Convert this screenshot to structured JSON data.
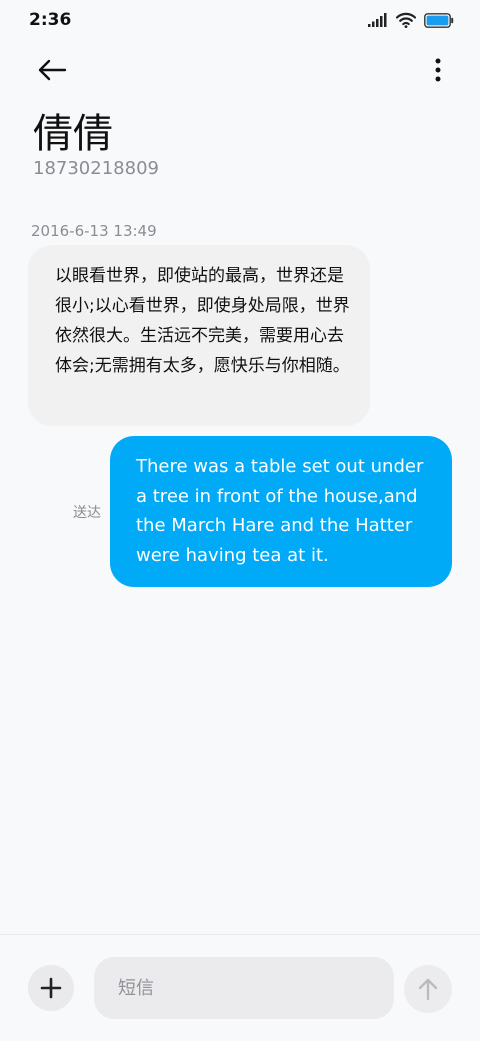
{
  "status_bar": {
    "time": "2:36",
    "icons": [
      "signal-icon",
      "wifi-icon",
      "battery-icon"
    ],
    "battery_color": "#1a9cf0"
  },
  "app_bar": {
    "back_icon": "arrow-left-icon",
    "more_icon": "more-vertical-icon"
  },
  "contact": {
    "name": "倩倩",
    "number": "18730218809"
  },
  "messages": [
    {
      "direction": "incoming",
      "timestamp": "2016-6-13 13:49",
      "text": "以眼看世界，即使站的最高，世界还是很小;以心看世界，即使身处局限，世界依然很大。生活远不完美，需要用心去体会;无需拥有太多，愿快乐与你相随。"
    },
    {
      "direction": "outgoing",
      "status": "送达",
      "text": "There was a table set out under a tree in front of the house,and the March Hare and the Hatter were having tea at it."
    }
  ],
  "composer": {
    "add_icon": "plus-icon",
    "placeholder": "短信",
    "value": "",
    "send_icon": "arrow-up-icon"
  },
  "colors": {
    "outgoing_bubble": "#00aaf7",
    "incoming_bubble": "#f1f1f1",
    "background": "#f8f9fb"
  }
}
